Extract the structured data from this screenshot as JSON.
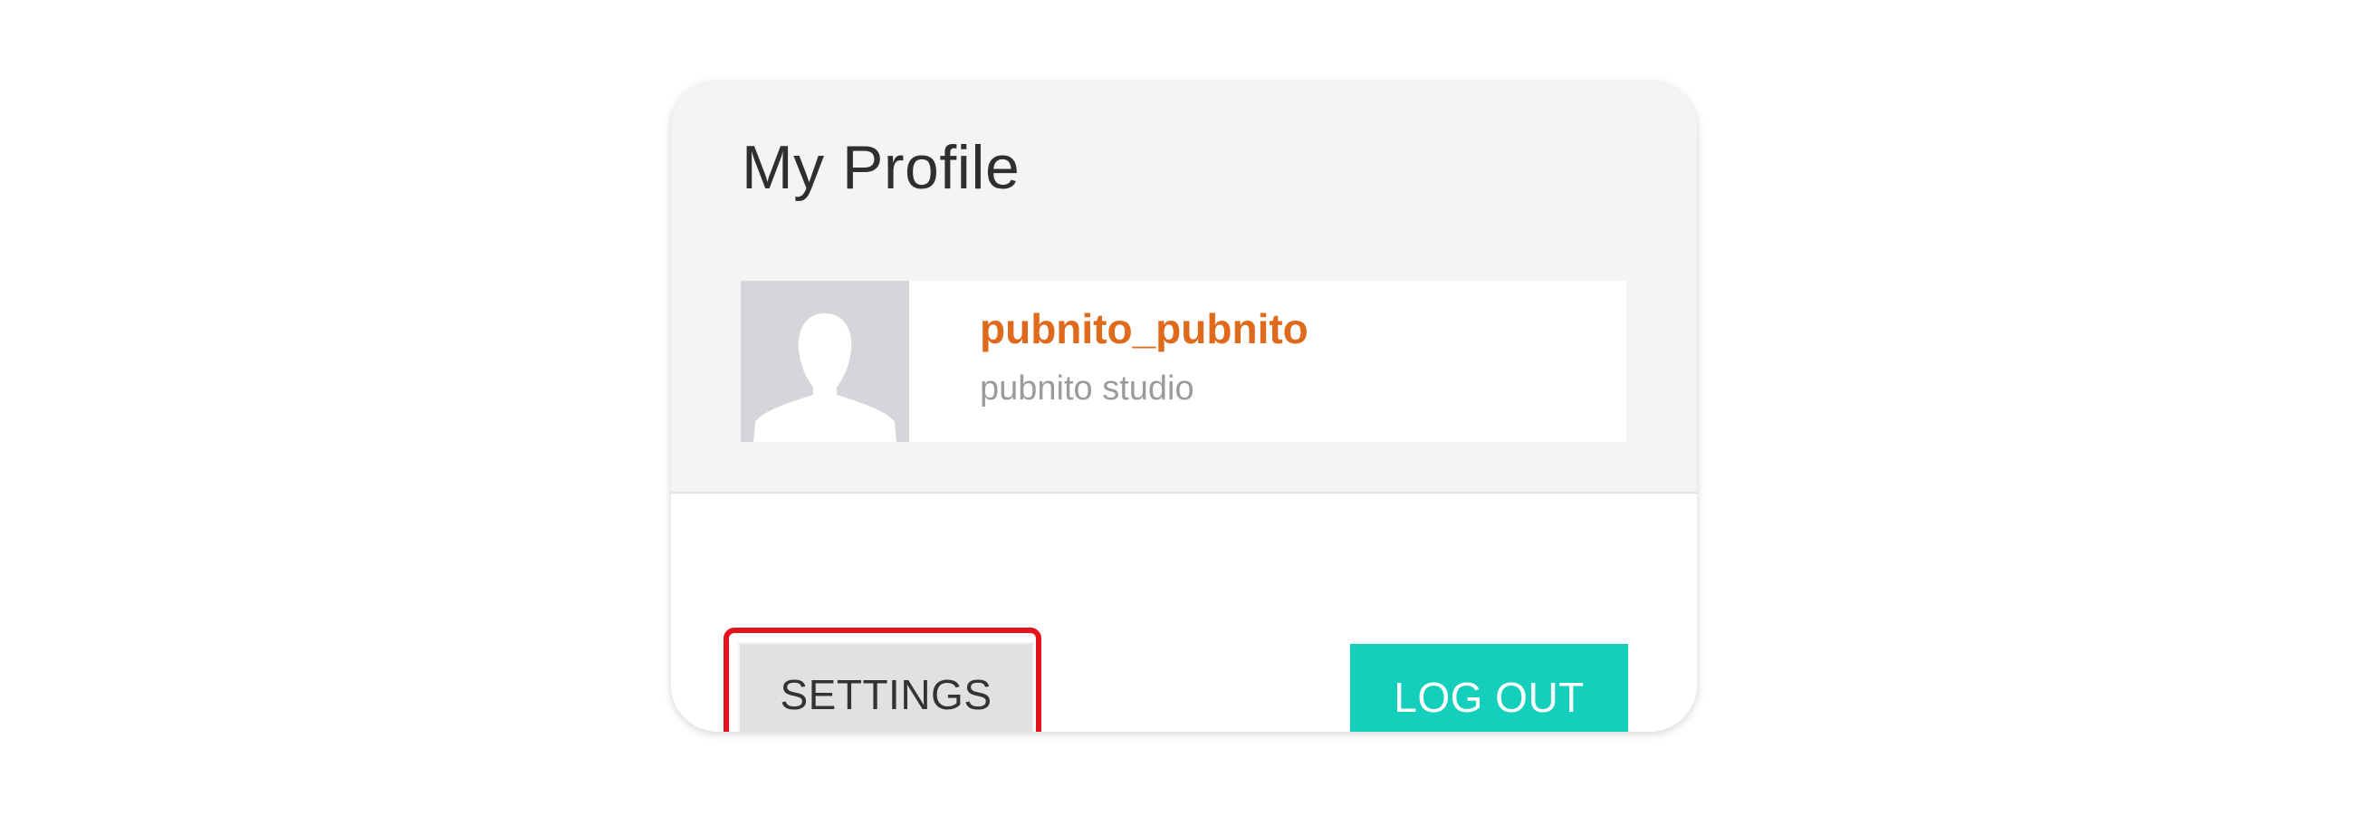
{
  "profile": {
    "title": "My Profile",
    "username": "pubnito_pubnito",
    "company": "pubnito studio",
    "avatar_icon": "user-silhouette-icon"
  },
  "actions": {
    "settings_label": "SETTINGS",
    "logout_label": "LOG OUT"
  },
  "colors": {
    "username": "#e06a1b",
    "logout_button": "#13cfbb",
    "settings_button": "#e1e1e1",
    "highlight": "#e3141c"
  }
}
